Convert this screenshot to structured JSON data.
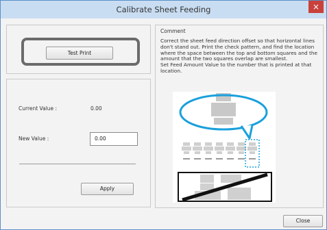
{
  "window": {
    "title": "Calibrate Sheet Feeding",
    "close_glyph": "×"
  },
  "left": {
    "test_print_label": "Test Print",
    "current_value_label": "Current Value :",
    "current_value": "0.00",
    "new_value_label": "New Value :",
    "new_value": "0.00",
    "apply_label": "Apply"
  },
  "comment": {
    "heading": "Comment",
    "text": "Correct the sheet feed direction offset so that horizontal lines don't stand out. Print the check pattern, and find the location where the space between the top and bottom squares and the amount that the two squares overlap are smallest.\nSet Feed Amount Value to the number that is printed at that location."
  },
  "footer": {
    "close_label": "Close"
  },
  "colors": {
    "accent": "#1aa0dc",
    "close_red": "#c9413a"
  }
}
